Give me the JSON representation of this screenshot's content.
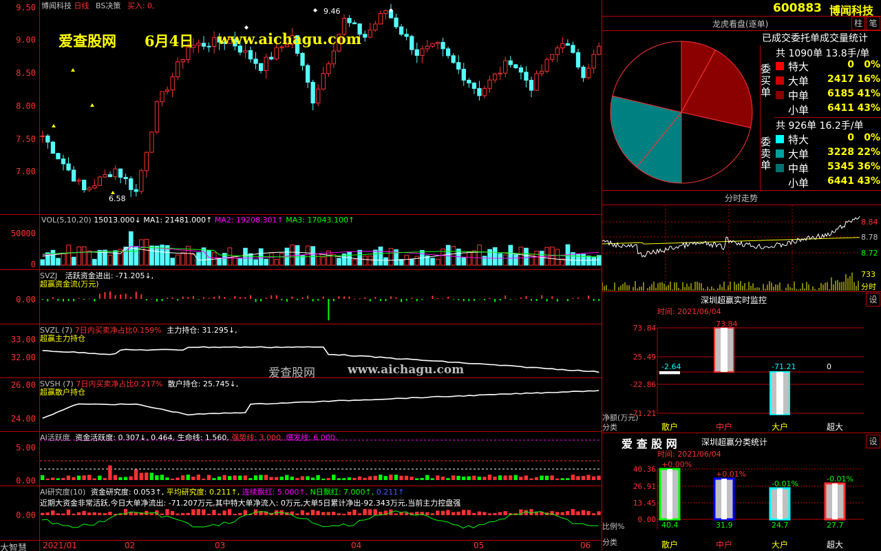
{
  "stock": {
    "code": "600883",
    "name": "博闻科技"
  },
  "main_chart": {
    "title": "博闻科技",
    "period": "日线",
    "indicator": "BS决策",
    "buy_label": "买入: 0,",
    "high_label": "9.46",
    "low_label": "6.58",
    "y_ticks": [
      "9.50",
      "9.00",
      "8.50",
      "8.00",
      "7.50",
      "7.00"
    ]
  },
  "watermark": {
    "site": "爱查股网",
    "date": "6月4日",
    "url": "www.aichagu.com"
  },
  "watermark2": {
    "site": "爱查股网",
    "url": "www.aichagu.com"
  },
  "vol_panel": {
    "name": "VOL(5,10,20)",
    "value": "15013.000↓",
    "ma1": "MA1: 21481.000↑",
    "ma2": "MA2: 19208.301↑",
    "ma3": "MA3: 17043.100↑",
    "y_ticks": [
      "50000",
      "0"
    ]
  },
  "svzj_panel": {
    "name": "SVZJ",
    "desc": "活跃资金进出: -71.205↓,",
    "sub": "超赢资金流(万元)",
    "y_ticks": [
      "0.00"
    ]
  },
  "svzl_panel": {
    "name": "SVZL (7)",
    "desc": "7日内买卖净占比0.159%",
    "desc2": "主力持仓: 31.295↓,",
    "sub": "超赢主力持仓",
    "y_ticks": [
      "33.00",
      "32.00"
    ]
  },
  "svsh_panel": {
    "name": "SVSH (7)",
    "desc": "7日内买卖净占比0.217%",
    "desc2": "散户持仓: 25.745↓,",
    "sub": "超赢散户持仓",
    "y_ticks": [
      "26.00",
      "24.00"
    ]
  },
  "ai_active_panel": {
    "name": "AI活跃度",
    "desc": "资金活跃度: 0.307↓, 0.464,",
    "life": "生命线: 1.560,",
    "strong": "强势线: 3.000,",
    "burst": "爆发线: 6.000,",
    "y_ticks": [
      "5.00",
      "0.00"
    ]
  },
  "ai_research_panel": {
    "name": "AI研究度(10)",
    "desc": "资金研究度: 0.053↑,",
    "avg": "平均研究度: 0.211↑,",
    "cont": "连续飘红: 5.000↑,",
    "n_day": "N日飘红: 7.000↑,",
    "last": "0.211↑",
    "comment": "近期大资金非常活跃,今日大单净流出: -71.207万元,其中特大单净流入: 0万元,大单5日累计净出-92.343万元,当前主力控盘强",
    "y_ticks": [
      "0.00"
    ]
  },
  "date_axis": [
    "2021/01",
    "02",
    "03",
    "04",
    "05",
    "06"
  ],
  "bottom_label": "大智慧",
  "top_buttons": [
    "柱",
    "笔"
  ],
  "longhu": {
    "title": "龙虎看盘(逐单)",
    "stat_title": "已成交委托单成交量统计",
    "buy_label": "委买单",
    "sell_label": "委卖单",
    "buy_total": "共 1090单 13.8手/单",
    "sell_total": "共 926单 16.2手/单",
    "buy_rows": [
      {
        "name": "特大",
        "count": "0",
        "pct": "0%",
        "color": "#ff0000"
      },
      {
        "name": "大单",
        "count": "2417",
        "pct": "16%",
        "color": "#cc0000"
      },
      {
        "name": "中单",
        "count": "6185",
        "pct": "41%",
        "color": "#880000"
      },
      {
        "name": "小单",
        "count": "6411",
        "pct": "43%",
        "color": "#000000"
      }
    ],
    "sell_rows": [
      {
        "name": "特大",
        "count": "0",
        "pct": "0%",
        "color": "#00ffff"
      },
      {
        "name": "大单",
        "count": "3228",
        "pct": "22%",
        "color": "#00a0a0"
      },
      {
        "name": "中单",
        "count": "5345",
        "pct": "36%",
        "color": "#007070"
      },
      {
        "name": "小单",
        "count": "6441",
        "pct": "43%",
        "color": "#000000"
      }
    ]
  },
  "intraday": {
    "title": "分时走势",
    "y_ticks": [
      "8.84",
      "8.78",
      "8.72"
    ],
    "vol_label": "733",
    "vol_unit": "分时"
  },
  "monitor": {
    "title": "深圳超赢实时监控",
    "time": "时间: 2021/06/04",
    "settings": "设",
    "y_ticks": [
      "73.84",
      "25.49",
      "-22.86",
      "-71.21"
    ],
    "unit": "净额(万元)",
    "cat_label": "分类",
    "categories": [
      "散户",
      "中户",
      "大户",
      "超大"
    ],
    "values": [
      "-2.64",
      "73.84",
      "-71.21",
      "0"
    ]
  },
  "classify": {
    "logo": "爱 查 股 网",
    "title": "深圳超赢分类统计",
    "time": "时间: 2021/06/04",
    "settings": "设",
    "y_ticks": [
      "40.36",
      "26.91",
      "13.45",
      "0.00"
    ],
    "ratio_label": "比例%",
    "cat_label": "分类",
    "categories": [
      "散户",
      "中户",
      "大户",
      "超大"
    ],
    "changes": [
      "+0.00%",
      "+0.01%",
      "-0.01%",
      "-0.01%"
    ],
    "values": [
      "40.4",
      "31.9",
      "24.7",
      "27.7"
    ]
  }
}
